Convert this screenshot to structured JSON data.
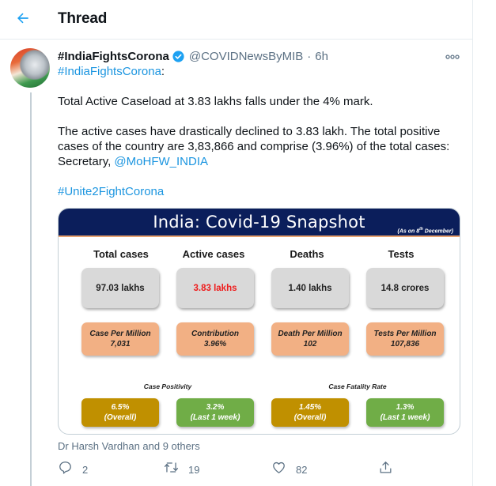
{
  "header": {
    "title": "Thread",
    "back_icon": "arrow-left-icon"
  },
  "tweet": {
    "display_name": "#IndiaFightsCorona",
    "verified": true,
    "handle": "@COVIDNewsByMIB",
    "separator": "·",
    "time": "6h",
    "more_icon": "more-icon",
    "text": {
      "hashtag_intro": "#IndiaFightsCorona",
      "hashtag_intro_suffix": ":",
      "line1": "Total Active Caseload at 3.83 lakhs falls under the 4% mark.",
      "para2": "The active cases have drastically declined to 3.83 lakh. The total positive cases of the country are 3,83,866 and comprise (3.96%) of the total cases: Secretary, ",
      "mention": "@MoHFW_INDIA",
      "hashtag_end": "#Unite2FightCorona"
    },
    "media": {
      "title": "India: Covid-19 Snapshot",
      "subtitle_prefix": "(As on 8",
      "subtitle_sup": "th",
      "subtitle_suffix": " December)",
      "columns": [
        {
          "heading": "Total cases",
          "value": "97.03 lakhs",
          "per_label": "Case Per Million",
          "per_value": "7,031"
        },
        {
          "heading": "Active cases",
          "value": "3.83 lakhs",
          "per_label": "Contribution",
          "per_value": "3.96%"
        },
        {
          "heading": "Deaths",
          "value": "1.40 lakhs",
          "per_label": "Death Per Million",
          "per_value": "102"
        },
        {
          "heading": "Tests",
          "value": "14.8 crores",
          "per_label": "Tests Per Million",
          "per_value": "107,836"
        }
      ],
      "groups": [
        {
          "label": "Case Positivity",
          "items": [
            {
              "value": "6.5%",
              "period": "(Overall)"
            },
            {
              "value": "3.2%",
              "period": "(Last 1 week)"
            }
          ]
        },
        {
          "label": "Case Fatality Rate",
          "items": [
            {
              "value": "1.45%",
              "period": "(Overall)"
            },
            {
              "value": "1.3%",
              "period": "(Last 1 week)"
            }
          ]
        }
      ],
      "colors": {
        "banner": "#0b1e5b",
        "stat_box": "#d9d9d9",
        "active_value": "#ee1c1c",
        "per_box": "#f2b084",
        "overall_box": "#c09000",
        "week_box": "#70ad47"
      }
    },
    "liked_by": "Dr Harsh Vardhan and 9 others",
    "actions": {
      "reply": {
        "icon": "reply-icon",
        "count": "2"
      },
      "retweet": {
        "icon": "retweet-icon",
        "count": "19"
      },
      "like": {
        "icon": "heart-icon",
        "count": "82"
      },
      "share": {
        "icon": "share-icon"
      }
    }
  },
  "colors": {
    "link": "#1b95e0",
    "secondary_text": "#5b7083",
    "verified": "#1da1f2"
  }
}
